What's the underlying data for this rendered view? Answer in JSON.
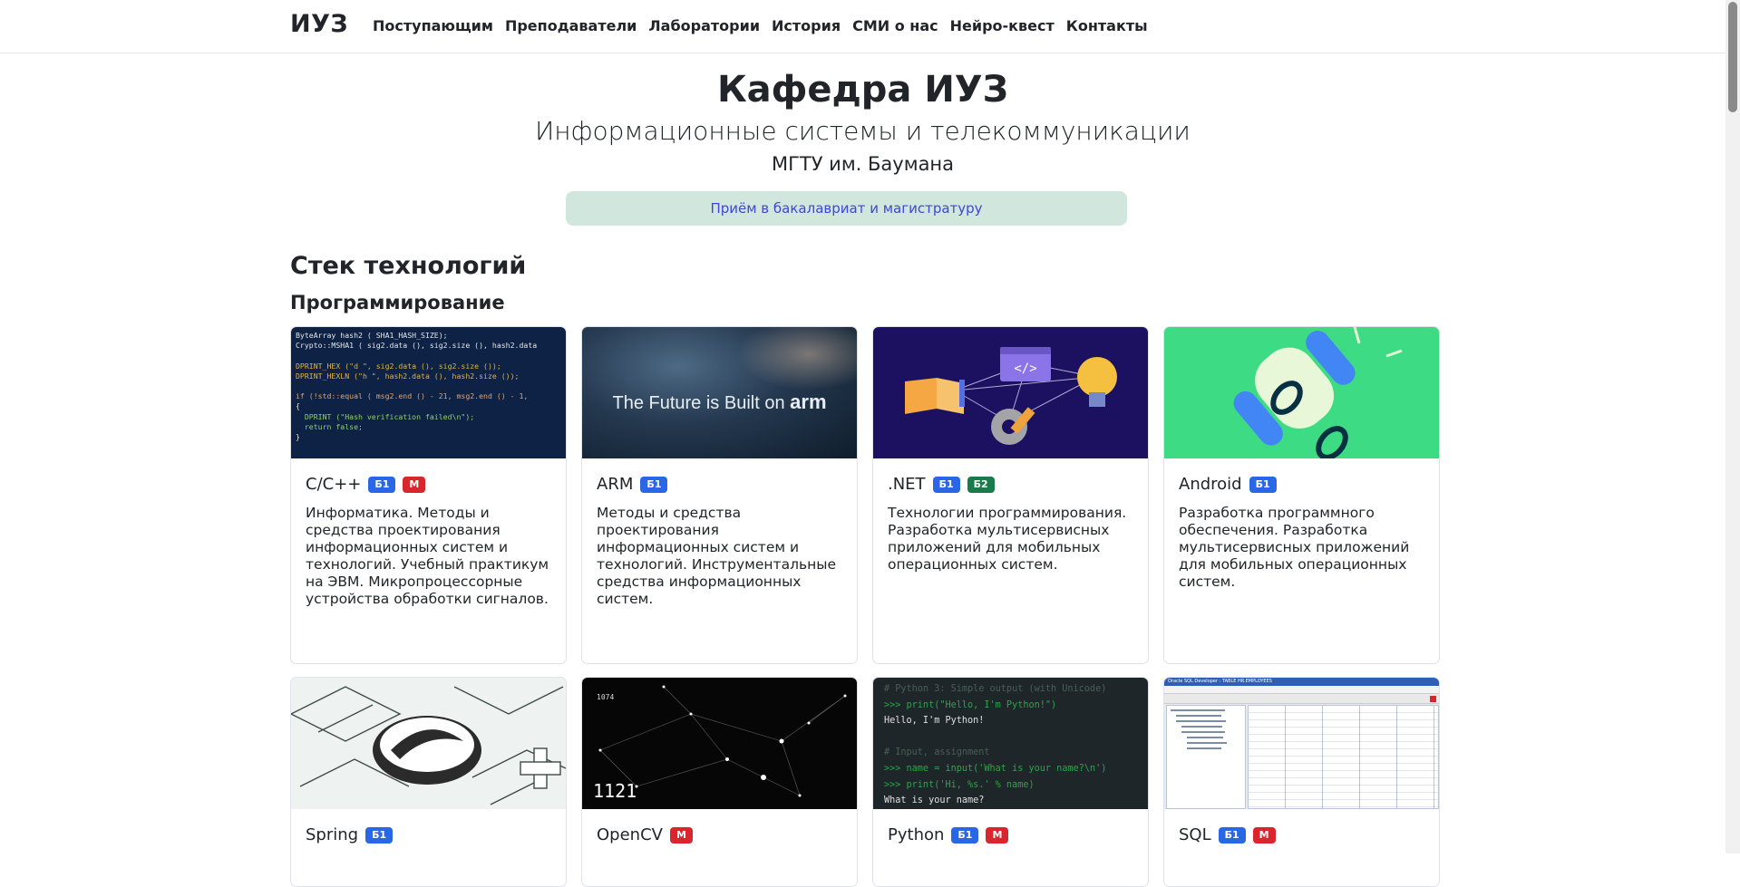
{
  "nav": {
    "brand": "ИУЗ",
    "links": [
      "Поступающим",
      "Преподаватели",
      "Лаборатории",
      "История",
      "СМИ о нас",
      "Нейро-квест",
      "Контакты"
    ]
  },
  "hero": {
    "title": "Кафедра ИУЗ",
    "subtitle": "Информационные системы и телекоммуникации",
    "university": "МГТУ им. Баумана",
    "admission_link": "Приём в бакалавриат и магистратуру"
  },
  "stack": {
    "title": "Стек технологий",
    "subtitle": "Программирование"
  },
  "cards": [
    {
      "title": "C/C++",
      "badges": [
        {
          "label": "Б1",
          "color": "#2a67e6"
        },
        {
          "label": "М",
          "color": "#d9262c"
        }
      ],
      "text": "Информатика. Методы и средства проектирования информационных систем и технологий. Учебный практикум на ЭВМ. Микропроцессорные устройства обработки сигналов."
    },
    {
      "title": "ARM",
      "badges": [
        {
          "label": "Б1",
          "color": "#2a67e6"
        }
      ],
      "text": "Методы и средства проектирования информационных систем и технологий. Инструментальные средства информационных систем.",
      "image_text": "The Future is Built on",
      "image_logo": "arm"
    },
    {
      "title": ".NET",
      "badges": [
        {
          "label": "Б1",
          "color": "#2a67e6"
        },
        {
          "label": "Б2",
          "color": "#197a4a"
        }
      ],
      "text": "Технологии программирования. Разработка мультисервисных приложений для мобильных операционных систем."
    },
    {
      "title": "Android",
      "badges": [
        {
          "label": "Б1",
          "color": "#2a67e6"
        }
      ],
      "text": "Разработка программного обеспечения. Разработка мультисервисных приложений для мобильных операционных систем."
    },
    {
      "title": "Spring",
      "badges": [
        {
          "label": "Б1",
          "color": "#2a67e6"
        }
      ],
      "text": ""
    },
    {
      "title": "OpenCV",
      "badges": [
        {
          "label": "М",
          "color": "#d9262c"
        }
      ],
      "text": "",
      "image_text_1": "1074",
      "image_text_2": "1121"
    },
    {
      "title": "Python",
      "badges": [
        {
          "label": "Б1",
          "color": "#2a67e6"
        },
        {
          "label": "М",
          "color": "#d9262c"
        }
      ],
      "text": ""
    },
    {
      "title": "SQL",
      "badges": [
        {
          "label": "Б1",
          "color": "#2a67e6"
        },
        {
          "label": "М",
          "color": "#d9262c"
        }
      ],
      "text": ""
    }
  ],
  "code_cpp": [
    "ByteArray hash2 ( SHA1_HASH_SIZE);",
    "Crypto::MSHA1 ( sig2.data (), sig2.size (), hash2.data",
    "",
    "DPRINT_HEX (\"d \", sig2.data (), sig2.size ());",
    "DPRINT_HEXLN (\"h \", hash2.data (), hash2.size ());",
    "",
    "if (!std::equal ( msg2.end () - 21, msg2.end () - 1,",
    "{",
    "  DPRINT (\"Hash verification failed\\n\");",
    "  return false;",
    "}"
  ],
  "code_python": [
    "# Python 3: Simple output (with Unicode)",
    ">>> print(\"Hello, I'm Python!\")",
    "Hello, I'm Python!",
    "",
    "# Input, assignment",
    ">>> name = input('What is your name?\\n')",
    ">>> print('Hi, %s.' % name)",
    "What is your name?"
  ],
  "sql_window_title": "Oracle SQL Developer : TABLE HR.EMPLOYEES"
}
